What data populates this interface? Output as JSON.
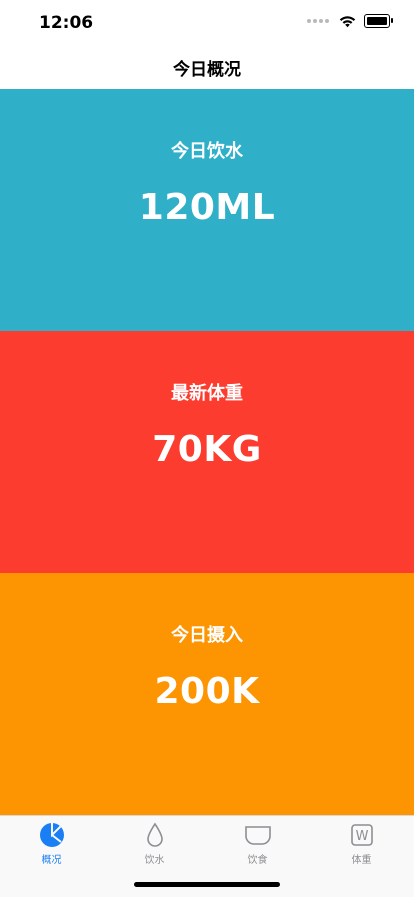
{
  "status_bar": {
    "time": "12:06"
  },
  "navigation": {
    "title": "今日概况"
  },
  "cards": [
    {
      "label": "今日饮水",
      "value": "120ML",
      "color": "#2fb0c8"
    },
    {
      "label": "最新体重",
      "value": "70KG",
      "color": "#fd3c30"
    },
    {
      "label": "今日摄入",
      "value": "200K",
      "color": "#fd9402"
    }
  ],
  "tab_bar": {
    "items": [
      {
        "label": "概况",
        "icon": "pie-chart-icon",
        "active": true
      },
      {
        "label": "饮水",
        "icon": "water-drop-icon",
        "active": false
      },
      {
        "label": "饮食",
        "icon": "bowl-icon",
        "active": false
      },
      {
        "label": "体重",
        "icon": "weight-w-icon",
        "active": false,
        "icon_text": "W"
      }
    ],
    "active_color": "#1a7ef5"
  }
}
